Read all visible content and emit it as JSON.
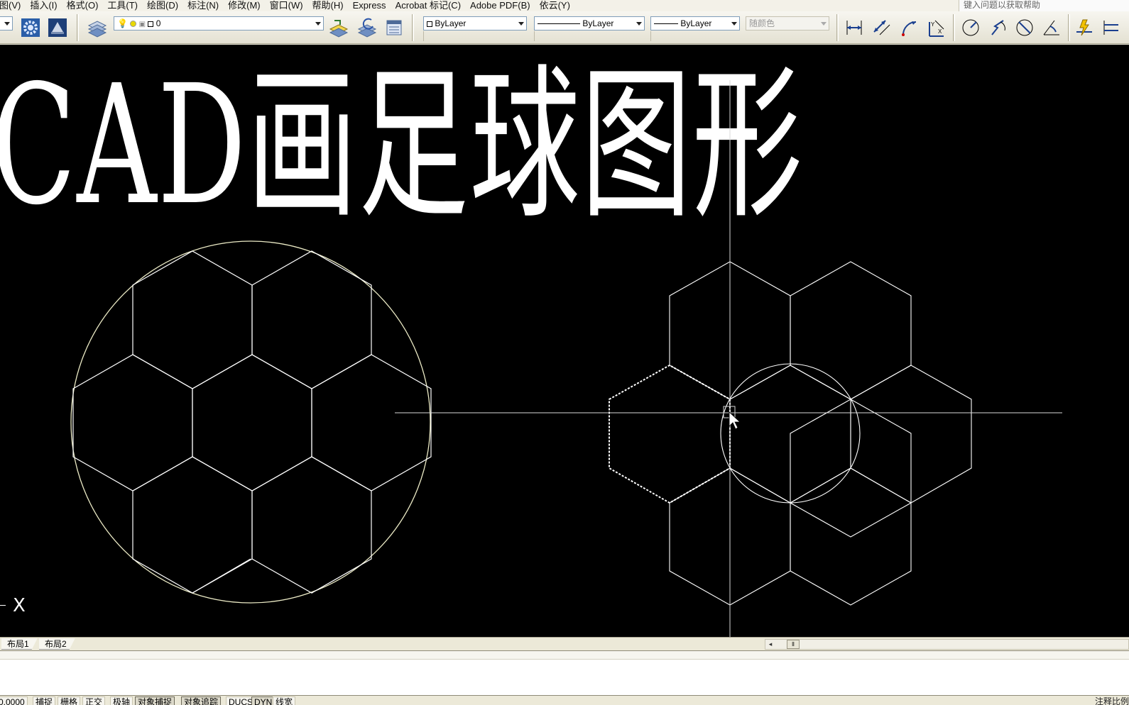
{
  "menubar": {
    "items": [
      "图(V)",
      "插入(I)",
      "格式(O)",
      "工具(T)",
      "绘图(D)",
      "标注(N)",
      "修改(M)",
      "窗口(W)",
      "帮助(H)",
      "Express",
      "Acrobat 标记(C)",
      "Adobe PDF(B)",
      "依云(Y)"
    ],
    "help_placeholder": "键入问题以获取帮助"
  },
  "toolbar": {
    "layer_combo": "0",
    "color_combo": "ByLayer",
    "linetype_combo": "ByLayer",
    "lineweight_combo": "ByLayer",
    "plotstyle_combo": "随颜色"
  },
  "drawing": {
    "title_text": "CAD画足球图形",
    "ucs_label": "X",
    "colors": {
      "background": "#000000",
      "lines": "#ffffff",
      "circle": "#f0f0c8"
    }
  },
  "tabs": {
    "layout1": "布局1",
    "layout2": "布局2"
  },
  "statusbar": {
    "coords": "0.0000",
    "buttons": [
      "捕捉",
      "栅格",
      "正交",
      "极轴",
      "对象捕捉",
      "对象追踪",
      "DUCS",
      "DYN",
      "线宽"
    ],
    "annotation": "注释比例"
  }
}
